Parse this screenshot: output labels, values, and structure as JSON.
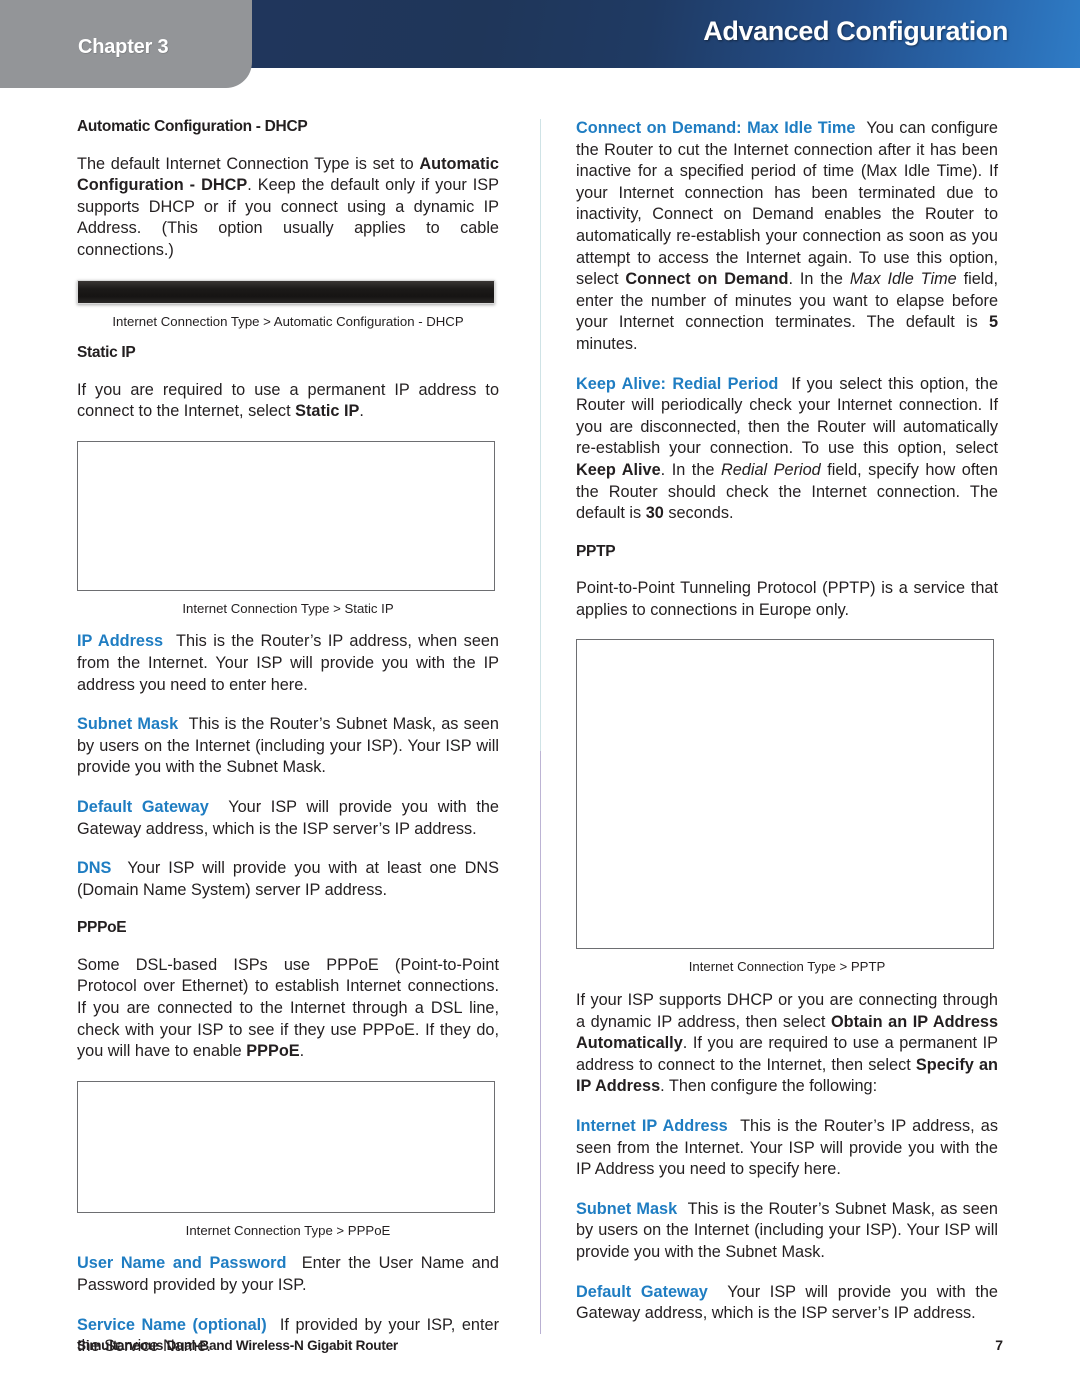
{
  "header": {
    "chapter_label": "Chapter 3",
    "title": "Advanced Configuration",
    "band_color_dark": "#20365c",
    "band_color_light": "#2f7cc6",
    "tab_color": "#939598"
  },
  "accent_color": "#1f7dc2",
  "left_column": {
    "dhcp_heading": "Automatic Configuration - DHCP",
    "dhcp_paragraph_pre": "The default Internet Connection Type is set to ",
    "dhcp_paragraph_bold1": "Automatic Configuration - DHCP",
    "dhcp_paragraph_post": ". Keep the default only if your ISP supports DHCP or if you connect using a dynamic IP Address. (This option usually applies to cable connections.)",
    "dhcp_caption": "Internet Connection Type > Automatic Configuration - DHCP",
    "static_heading": "Static IP",
    "static_paragraph_pre": "If you are required to use a permanent IP address to connect to the Internet, select ",
    "static_paragraph_bold": "Static IP",
    "static_paragraph_post": ".",
    "static_caption": "Internet Connection Type > Static IP",
    "ip_address_term": "IP Address",
    "ip_address_text": "This is the Router’s IP address, when seen from the Internet. Your ISP will provide you with the IP address you need to enter here.",
    "subnet_mask_term": "Subnet Mask",
    "subnet_mask_text": "This is the Router’s Subnet Mask, as seen by users on the Internet (including your ISP). Your ISP will provide you with the Subnet Mask.",
    "default_gateway_term": "Default Gateway",
    "default_gateway_text": "Your ISP will provide you with the Gateway address, which is the ISP server’s IP address.",
    "dns_term": "DNS",
    "dns_text": "Your ISP will provide you with at least one DNS (Domain Name System) server IP address.",
    "pppoe_heading": "PPPoE",
    "pppoe_paragraph_pre": "Some DSL-based ISPs use PPPoE (Point-to-Point Protocol over Ethernet) to establish Internet connections. If you are connected to the Internet through a DSL line, check with your ISP to see if they use PPPoE. If they do, you will have to enable ",
    "pppoe_paragraph_bold": "PPPoE",
    "pppoe_paragraph_post": ".",
    "pppoe_caption": "Internet Connection Type > PPPoE",
    "username_term": "User Name and Password",
    "username_text": "Enter the User Name and Password provided by your ISP.",
    "service_name_term": "Service Name (optional)",
    "service_name_text": "If provided by your ISP, enter the Service Name."
  },
  "right_column": {
    "connect_demand_term": "Connect on Demand: Max Idle Time",
    "connect_demand_p1": "You can configure the Router to cut the Internet connection after it has been inactive for a specified period of time (Max Idle Time). If your Internet connection has been terminated due to inactivity, Connect on Demand enables the Router to automatically re-establish your connection as soon as you attempt to access the Internet again. To use this option, select ",
    "connect_demand_bold1": "Connect on Demand",
    "connect_demand_p2": ". In the ",
    "connect_demand_ital1": "Max Idle Time",
    "connect_demand_p3": " field, enter the number of minutes you want to elapse before your Internet connection terminates. The default is ",
    "connect_demand_bold2": "5",
    "connect_demand_p4": " minutes.",
    "keep_alive_term": "Keep Alive: Redial Period",
    "keep_alive_p1": "If you select this option, the Router will periodically check your Internet connection. If you are disconnected, then the Router will automatically re-establish your connection. To use this option, select ",
    "keep_alive_bold1": "Keep Alive",
    "keep_alive_p2": ". In the ",
    "keep_alive_ital1": "Redial Period",
    "keep_alive_p3": " field, specify how often the Router should check the Internet connection. The default is ",
    "keep_alive_bold2": "30",
    "keep_alive_p4": " seconds.",
    "pptp_heading": "PPTP",
    "pptp_paragraph": "Point-to-Point Tunneling Protocol (PPTP) is a service that applies to connections in Europe only.",
    "pptp_caption": "Internet Connection Type > PPTP",
    "dhcp_obtain_p1": "If your ISP supports DHCP or you are connecting through a dynamic IP address, then select ",
    "dhcp_obtain_bold1": "Obtain an IP Address Automatically",
    "dhcp_obtain_p2": ". If you are required to use a permanent IP address to connect to the Internet, then select ",
    "dhcp_obtain_bold2": "Specify an IP Address",
    "dhcp_obtain_p3": ". Then configure the following:",
    "internet_ip_term": "Internet IP Address",
    "internet_ip_text": "This is the Router’s IP address, as seen from the Internet. Your ISP will provide you with the IP Address you need to specify here.",
    "subnet_mask_term": "Subnet Mask",
    "subnet_mask_text": "This is the Router’s Subnet Mask, as seen by users on the Internet (including your ISP). Your ISP will provide you with the Subnet Mask.",
    "default_gateway_term": "Default Gateway",
    "default_gateway_text": "Your ISP will provide you with the Gateway address, which is the ISP server’s IP address."
  },
  "footer": {
    "product_title": "Simultaneous Dual-Band Wireless-N Gigabit Router",
    "page_number": "7"
  }
}
